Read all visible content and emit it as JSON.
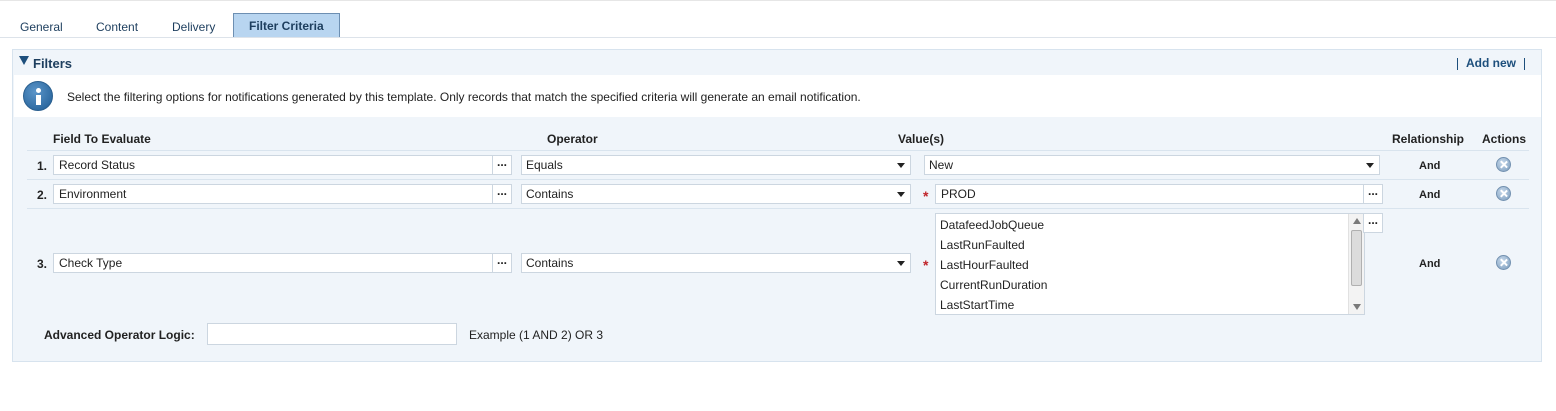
{
  "tabs": [
    {
      "label": "General",
      "active": false
    },
    {
      "label": "Content",
      "active": false
    },
    {
      "label": "Delivery",
      "active": false
    },
    {
      "label": "Filter Criteria",
      "active": true
    }
  ],
  "filters": {
    "title": "Filters",
    "add_new_label": "Add new",
    "info_text": "Select the filtering options for notifications generated by this template.  Only records that match the specified criteria will generate an email notification.",
    "columns": {
      "field": "Field To Evaluate",
      "operator": "Operator",
      "values": "Value(s)",
      "relationship": "Relationship",
      "actions": "Actions"
    },
    "rows": [
      {
        "num": "1.",
        "field": "Record Status",
        "operator": "Equals",
        "value": "New",
        "relationship": "And",
        "value_type": "select"
      },
      {
        "num": "2.",
        "field": "Environment",
        "operator": "Contains",
        "value": "PROD",
        "relationship": "And",
        "value_type": "text",
        "required": true
      },
      {
        "num": "3.",
        "field": "Check Type",
        "operator": "Contains",
        "relationship": "And",
        "value_type": "list",
        "required": true,
        "value_list": [
          "DatafeedJobQueue",
          "LastRunFaulted",
          "LastHourFaulted",
          "CurrentRunDuration",
          "LastStartTime"
        ]
      }
    ],
    "dots_label": "...",
    "required_marker": "*",
    "advanced": {
      "label": "Advanced Operator Logic:",
      "value": "",
      "example": "Example (1 AND 2) OR 3"
    }
  },
  "colors": {
    "active_tab_bg": "#b8d5f0",
    "panel_bg": "#f0f5fa",
    "accent": "#1d4f7c",
    "required": "#c0252b"
  }
}
